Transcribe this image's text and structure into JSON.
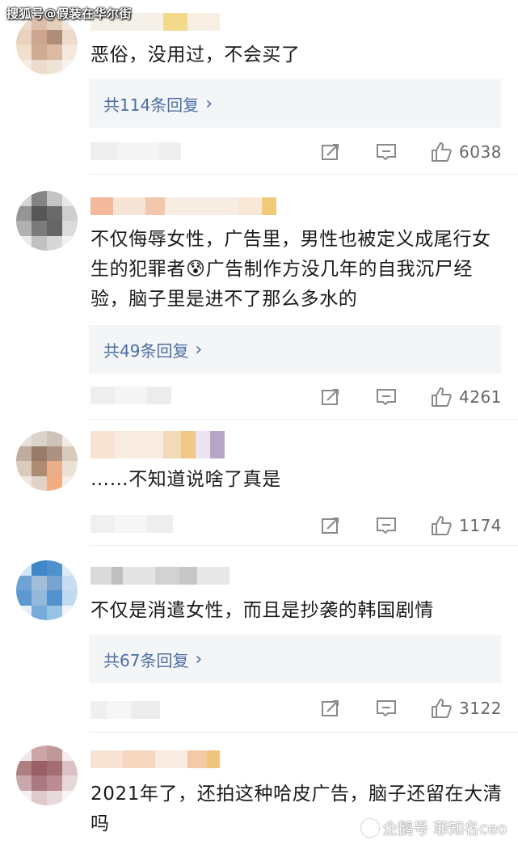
{
  "watermarks": {
    "top": "搜狐号@假装在华尔街",
    "bottom": "企鹅号 菲知名ceo"
  },
  "colors": {
    "reply_link": "#4a6ea5",
    "reply_bg": "#f4f5f7",
    "icon_gray": "#8a8a8a"
  },
  "comments": [
    {
      "text": "恶俗，没用过，不会买了",
      "replies": "共114条回复",
      "likes": "6038"
    },
    {
      "text": "不仅侮辱女性，广告里，男性也被定义成尾行女生的犯罪者😰广告制作方没几年的自我沉尸经验，脑子里是进不了那么多水的",
      "replies": "共49条回复",
      "likes": "4261"
    },
    {
      "text": "……不知道说啥了真是",
      "replies": "",
      "likes": "1174"
    },
    {
      "text": "不仅是消遣女性，而且是抄袭的韩国剧情",
      "replies": "共67条回复",
      "likes": "3122"
    },
    {
      "text": "2021年了，还拍这种哈皮广告，脑子还留在大清吗",
      "replies": "",
      "likes": ""
    }
  ],
  "icons": {
    "repost": "repost-icon",
    "comment": "comment-icon",
    "like": "like-icon",
    "chevron": "chevron-right-icon"
  }
}
